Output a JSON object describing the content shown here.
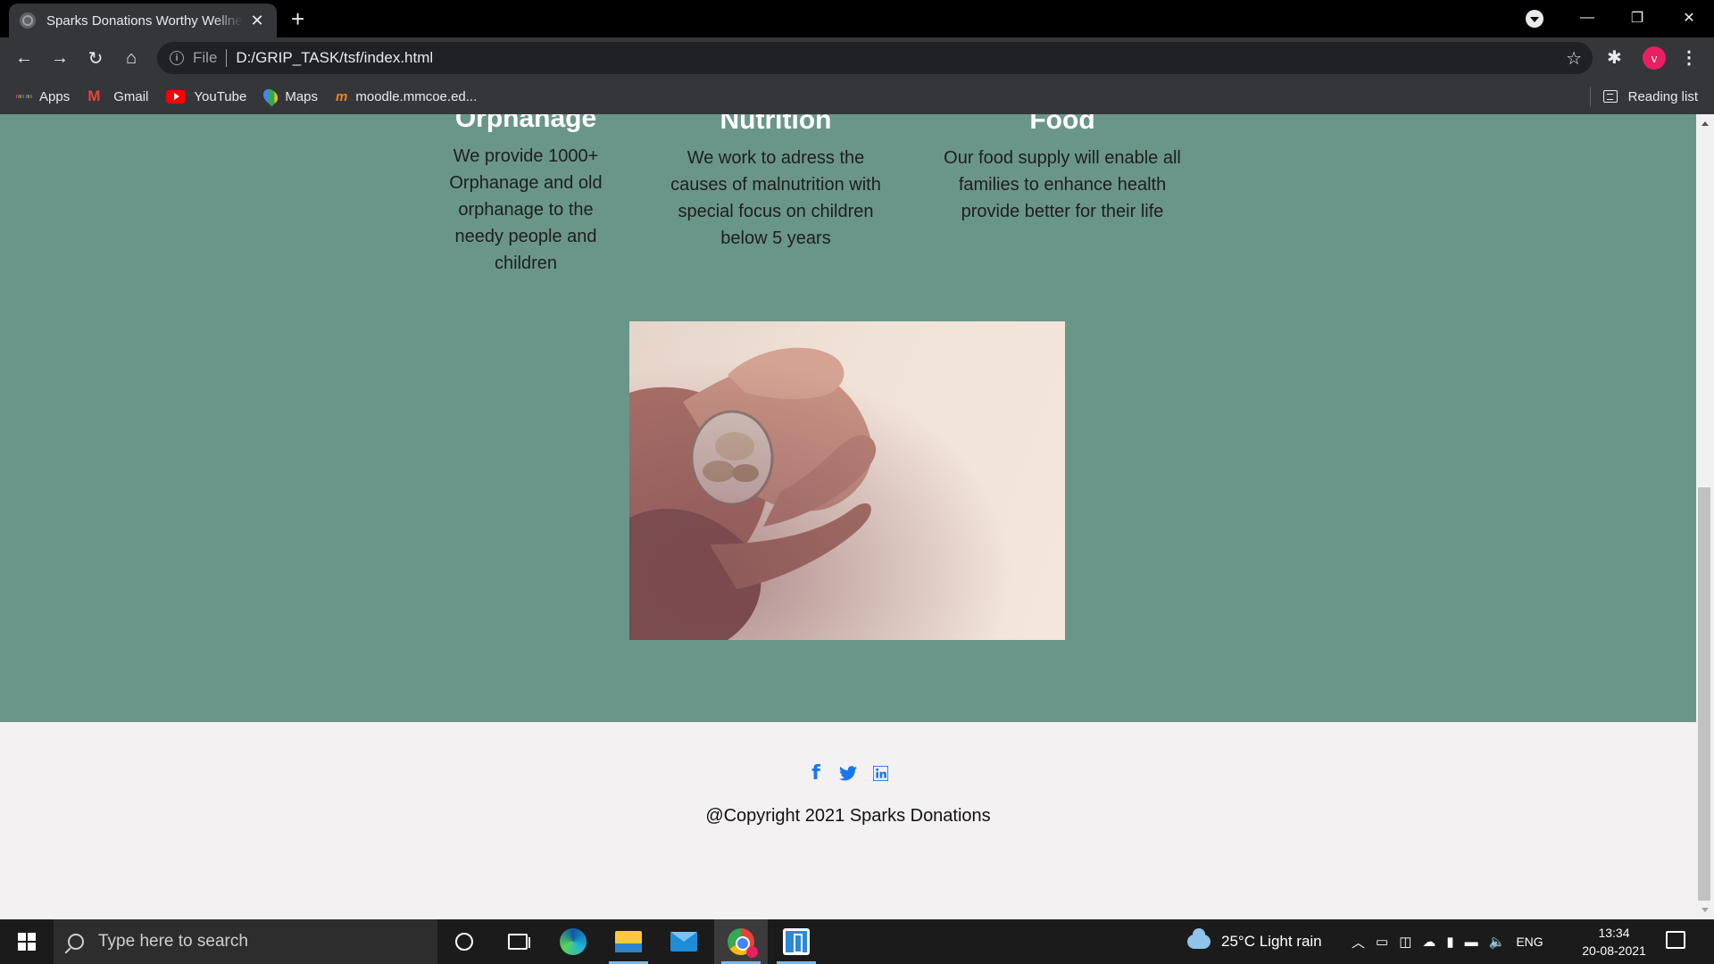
{
  "browser": {
    "tab_title": "Sparks Donations Worthy Wellness",
    "tab_close": "✕",
    "new_tab": "+",
    "win_minimize": "—",
    "win_restore": "❐",
    "win_close": "✕",
    "address_scheme": "File",
    "address_url": "D:/GRIP_TASK/tsf/index.html",
    "profile_initial": "v",
    "bookmarks": [
      {
        "label": "Apps",
        "icon": "apps-grid-icon"
      },
      {
        "label": "Gmail",
        "icon": "gmail-icon"
      },
      {
        "label": "YouTube",
        "icon": "youtube-icon"
      },
      {
        "label": "Maps",
        "icon": "maps-icon"
      },
      {
        "label": "moodle.mmcoe.ed...",
        "icon": "moodle-icon"
      }
    ],
    "reading_list": "Reading list"
  },
  "page": {
    "features": [
      {
        "title": "Orphanage",
        "text": "We provide 1000+ Orphanage and old orphanage to the needy people and children"
      },
      {
        "title": "Nutrition",
        "text": "We work to adress the causes of malnutrition with special focus on children below 5 years"
      },
      {
        "title": "Food",
        "text": "Our food supply will enable all families to enhance health provide better for their life"
      }
    ],
    "footer": {
      "copyright": "@Copyright 2021 Sparks Donations",
      "socials": [
        "facebook-icon",
        "twitter-icon",
        "linkedin-icon"
      ]
    },
    "colors": {
      "section_bg": "#6a9689",
      "footer_bg": "#f3f1f2",
      "social": "#1877f2"
    }
  },
  "taskbar": {
    "search_placeholder": "Type here to search",
    "weather": "25°C  Light rain",
    "language": "ENG",
    "time": "13:34",
    "date": "20-08-2021"
  }
}
